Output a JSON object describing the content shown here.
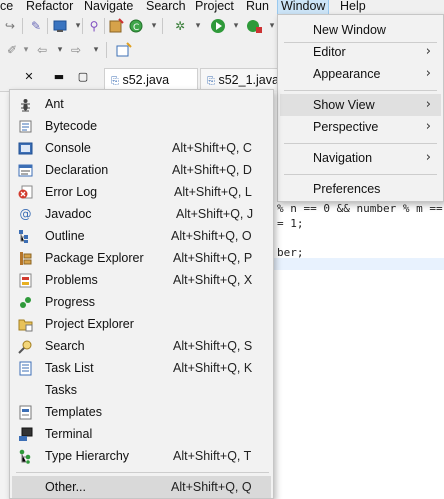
{
  "menubar": {
    "items": [
      "ce",
      "Refactor",
      "Navigate",
      "Search",
      "Project",
      "Run",
      "Window",
      "Help"
    ],
    "active": "Window"
  },
  "tabs": {
    "tab1": "s52.java",
    "tab2": "s52_1.java"
  },
  "editor": {
    "line1": "% n == 0 && number % m ==",
    "line2": "= 1;",
    "line3": "ber;"
  },
  "window_menu": {
    "items": [
      {
        "label": "New Window",
        "submenu": false
      },
      {
        "label": "Editor",
        "submenu": true
      },
      {
        "label": "Appearance",
        "submenu": true
      },
      {
        "label": "Show View",
        "submenu": true
      },
      {
        "label": "Perspective",
        "submenu": true
      },
      {
        "label": "Navigation",
        "submenu": true
      },
      {
        "label": "Preferences",
        "submenu": false
      }
    ],
    "highlighted": "Show View"
  },
  "show_view_menu": {
    "items": [
      {
        "label": "Ant",
        "shortcut": "",
        "icon": "ant-icon"
      },
      {
        "label": "Bytecode",
        "shortcut": "",
        "icon": "bytecode-icon"
      },
      {
        "label": "Console",
        "shortcut": "Alt+Shift+Q, C",
        "icon": "console-icon"
      },
      {
        "label": "Declaration",
        "shortcut": "Alt+Shift+Q, D",
        "icon": "declaration-icon"
      },
      {
        "label": "Error Log",
        "shortcut": "Alt+Shift+Q, L",
        "icon": "error-log-icon"
      },
      {
        "label": "Javadoc",
        "shortcut": "Alt+Shift+Q, J",
        "icon": "javadoc-icon"
      },
      {
        "label": "Outline",
        "shortcut": "Alt+Shift+Q, O",
        "icon": "outline-icon"
      },
      {
        "label": "Package Explorer",
        "shortcut": "Alt+Shift+Q, P",
        "icon": "package-explorer-icon"
      },
      {
        "label": "Problems",
        "shortcut": "Alt+Shift+Q, X",
        "icon": "problems-icon"
      },
      {
        "label": "Progress",
        "shortcut": "",
        "icon": "progress-icon"
      },
      {
        "label": "Project Explorer",
        "shortcut": "",
        "icon": "project-explorer-icon"
      },
      {
        "label": "Search",
        "shortcut": "Alt+Shift+Q, S",
        "icon": "search-icon"
      },
      {
        "label": "Task List",
        "shortcut": "Alt+Shift+Q, K",
        "icon": "task-list-icon"
      },
      {
        "label": "Tasks",
        "shortcut": "",
        "icon": "tasks-icon"
      },
      {
        "label": "Templates",
        "shortcut": "",
        "icon": "templates-icon"
      },
      {
        "label": "Terminal",
        "shortcut": "",
        "icon": "terminal-icon"
      },
      {
        "label": "Type Hierarchy",
        "shortcut": "Alt+Shift+Q, T",
        "icon": "type-hierarchy-icon"
      },
      {
        "label": "Other...",
        "shortcut": "Alt+Shift+Q, Q",
        "icon": ""
      }
    ],
    "highlighted": "Other..."
  },
  "colors": {
    "menu_bg": "#f2f2f2",
    "highlight": "#e0e0e0",
    "menubar_active": "#cce4f7"
  }
}
